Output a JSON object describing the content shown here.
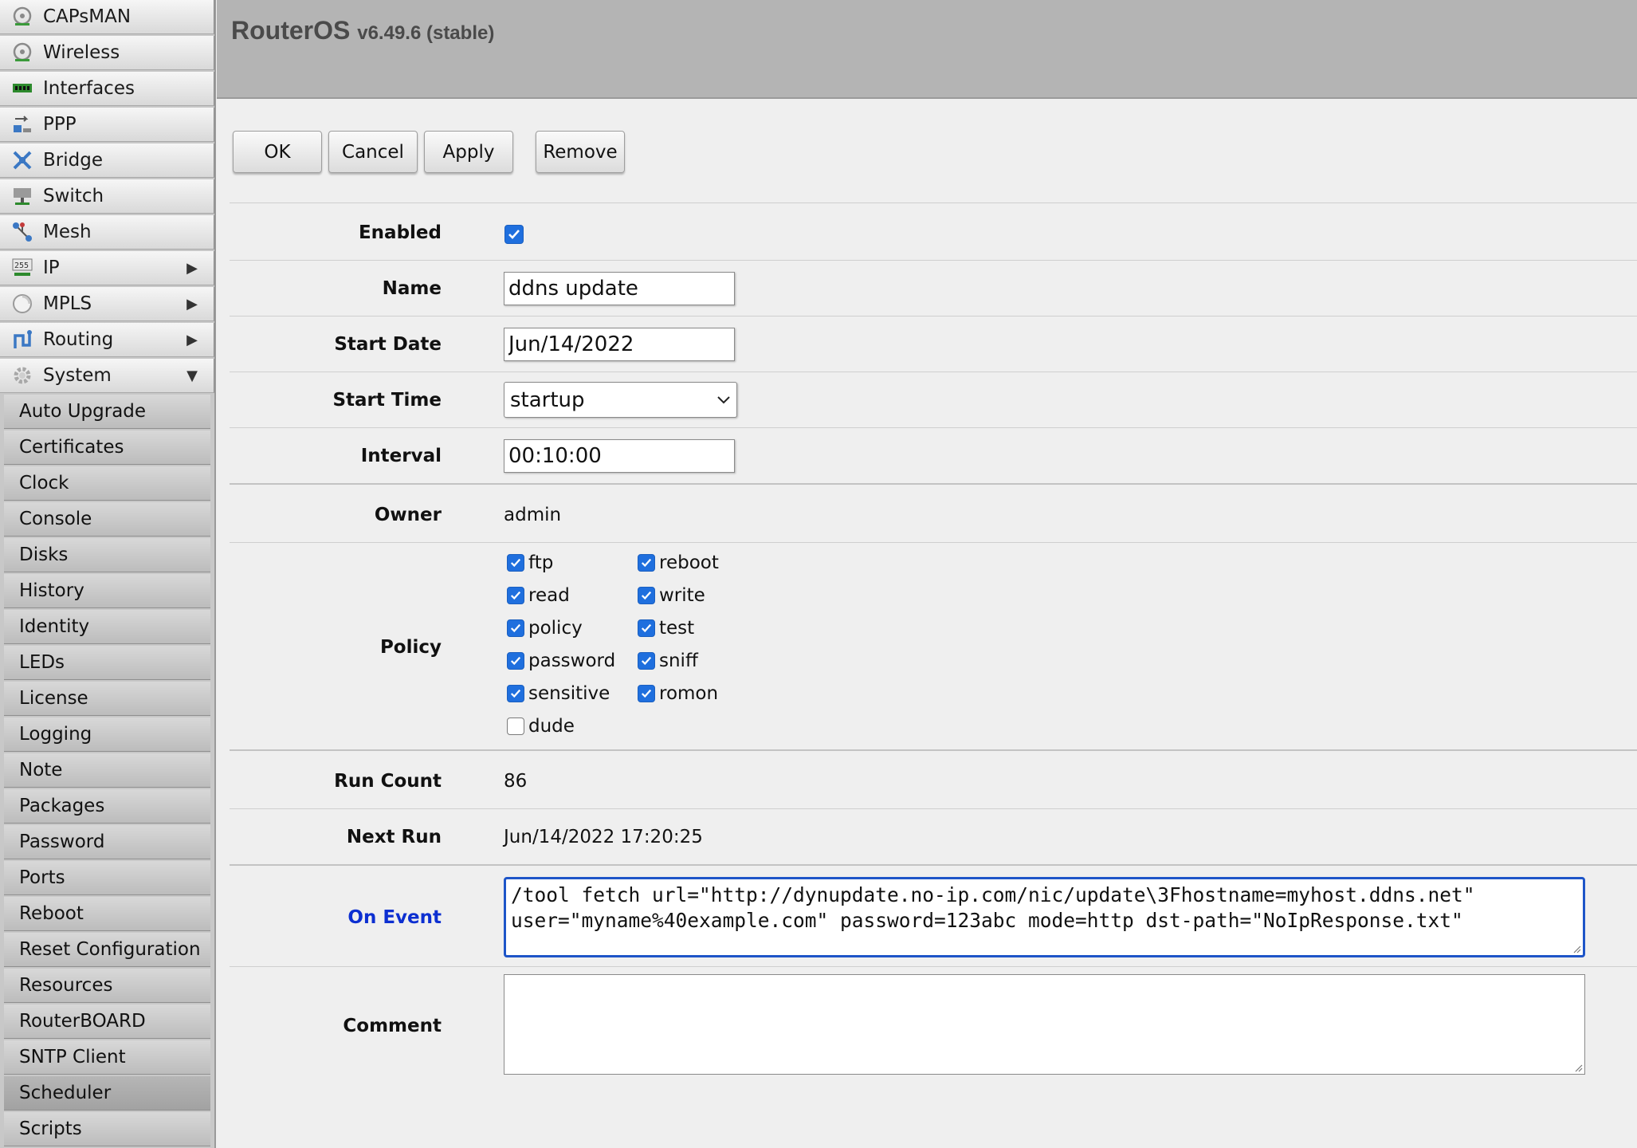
{
  "sidebar": {
    "items": [
      {
        "label": "CAPsMAN",
        "icon": "capsman-icon",
        "arrow": ""
      },
      {
        "label": "Wireless",
        "icon": "wireless-icon",
        "arrow": ""
      },
      {
        "label": "Interfaces",
        "icon": "interfaces-icon",
        "arrow": ""
      },
      {
        "label": "PPP",
        "icon": "ppp-icon",
        "arrow": ""
      },
      {
        "label": "Bridge",
        "icon": "bridge-icon",
        "arrow": ""
      },
      {
        "label": "Switch",
        "icon": "switch-icon",
        "arrow": ""
      },
      {
        "label": "Mesh",
        "icon": "mesh-icon",
        "arrow": ""
      },
      {
        "label": "IP",
        "icon": "ip-icon",
        "arrow": "▶"
      },
      {
        "label": "MPLS",
        "icon": "mpls-icon",
        "arrow": "▶"
      },
      {
        "label": "Routing",
        "icon": "routing-icon",
        "arrow": "▶"
      },
      {
        "label": "System",
        "icon": "system-gear-icon",
        "arrow": "▼"
      }
    ],
    "submenu": [
      "Auto Upgrade",
      "Certificates",
      "Clock",
      "Console",
      "Disks",
      "History",
      "Identity",
      "LEDs",
      "License",
      "Logging",
      "Note",
      "Packages",
      "Password",
      "Ports",
      "Reboot",
      "Reset Configuration",
      "Resources",
      "RouterBOARD",
      "SNTP Client",
      "Scheduler",
      "Scripts"
    ],
    "active_submenu": "Scheduler"
  },
  "header": {
    "app_name": "RouterOS",
    "version": "v6.49.6 (stable)"
  },
  "toolbar": {
    "ok": "OK",
    "cancel": "Cancel",
    "apply": "Apply",
    "remove": "Remove"
  },
  "form": {
    "enabled": {
      "label": "Enabled",
      "checked": true
    },
    "name": {
      "label": "Name",
      "value": "ddns update"
    },
    "start_date": {
      "label": "Start Date",
      "value": "Jun/14/2022"
    },
    "start_time": {
      "label": "Start Time",
      "value": "startup"
    },
    "interval": {
      "label": "Interval",
      "value": "00:10:00"
    },
    "owner": {
      "label": "Owner",
      "value": "admin"
    },
    "policy": {
      "label": "Policy",
      "left": [
        {
          "name": "ftp",
          "checked": true
        },
        {
          "name": "read",
          "checked": true
        },
        {
          "name": "policy",
          "checked": true
        },
        {
          "name": "password",
          "checked": true
        },
        {
          "name": "sensitive",
          "checked": true
        },
        {
          "name": "dude",
          "checked": false
        }
      ],
      "right": [
        {
          "name": "reboot",
          "checked": true
        },
        {
          "name": "write",
          "checked": true
        },
        {
          "name": "test",
          "checked": true
        },
        {
          "name": "sniff",
          "checked": true
        },
        {
          "name": "romon",
          "checked": true
        }
      ]
    },
    "run_count": {
      "label": "Run Count",
      "value": "86"
    },
    "next_run": {
      "label": "Next Run",
      "value": "Jun/14/2022 17:20:25"
    },
    "on_event": {
      "label": "On Event",
      "line1": "/tool fetch url=\"http://dynupdate.no-ip.com/nic/update\\3Fhostname=myhost.ddns.net\"",
      "line2": "user=\"myname%40example.com\" password=123abc mode=http dst-path=\"NoIpResponse.txt\""
    },
    "comment": {
      "label": "Comment",
      "value": ""
    }
  },
  "colors": {
    "checkbox_on": "#1f6fde",
    "on_event_label": "#0c2fd1",
    "focus_border": "#1e55c8"
  }
}
